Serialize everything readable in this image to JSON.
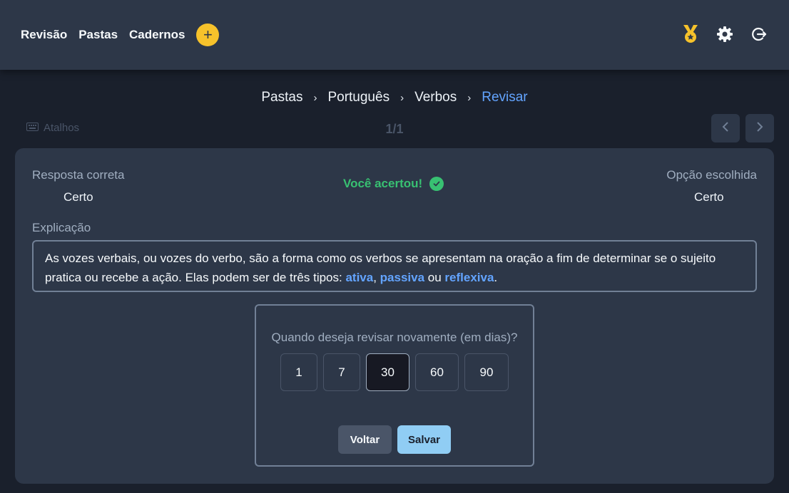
{
  "nav": {
    "items": [
      "Revisão",
      "Pastas",
      "Cadernos"
    ],
    "add_symbol": "+"
  },
  "top_icons": [
    "medal-icon",
    "gear-icon",
    "logout-icon"
  ],
  "breadcrumb": {
    "items": [
      "Pastas",
      "Português",
      "Verbos"
    ],
    "active": "Revisar"
  },
  "toolbar": {
    "shortcuts_label": "Atalhos",
    "counter": "1/1"
  },
  "card": {
    "correct_label": "Resposta correta",
    "correct_value": "Certo",
    "result": "Você acertou!",
    "chosen_label": "Opção escolhida",
    "chosen_value": "Certo",
    "explanation_label": "Explicação",
    "explanation": {
      "part1": "As vozes verbais, ou vozes do verbo, são a forma como os verbos se apresentam na oração a fim de determinar se o sujeito pratica ou recebe a ação. Elas podem ser de três tipos: ",
      "term1": "ativa",
      "sep1": ", ",
      "term2": "passiva",
      "sep2": " ou ",
      "term3": "reflexiva",
      "end": "."
    }
  },
  "review": {
    "question": "Quando deseja revisar novamente (em dias)?",
    "options": [
      "1",
      "7",
      "30",
      "60",
      "90"
    ],
    "selected": "30",
    "back_label": "Voltar",
    "save_label": "Salvar"
  },
  "colors": {
    "accent": "#63a4ff",
    "success": "#38c172",
    "add_button": "#f6c22b",
    "medal": "#f6c22b"
  }
}
